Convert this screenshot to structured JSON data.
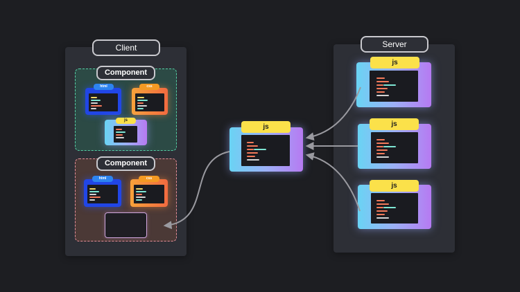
{
  "client": {
    "title": "Client",
    "components": [
      {
        "title": "Component",
        "tags": {
          "html": "html",
          "css": "css",
          "js": "js"
        }
      },
      {
        "title": "Component",
        "tags": {
          "html": "html",
          "css": "css"
        }
      }
    ]
  },
  "server": {
    "title": "Server",
    "files": [
      {
        "tag": "js"
      },
      {
        "tag": "js"
      },
      {
        "tag": "js"
      }
    ]
  },
  "bundle": {
    "tag": "js"
  },
  "colors": {
    "background": "#1d1e22",
    "panel": "#2d2f36",
    "js_tag": "#fbe14a",
    "html_tag": "#2d84f0",
    "css_tag": "#f59a23",
    "component1_border": "#55cfa5",
    "component2_border": "#e88e9a",
    "arrow": "#9a9aa0"
  },
  "icons": [
    "arrow-right-icon",
    "arrow-left-icon",
    "code-lines-icon"
  ]
}
